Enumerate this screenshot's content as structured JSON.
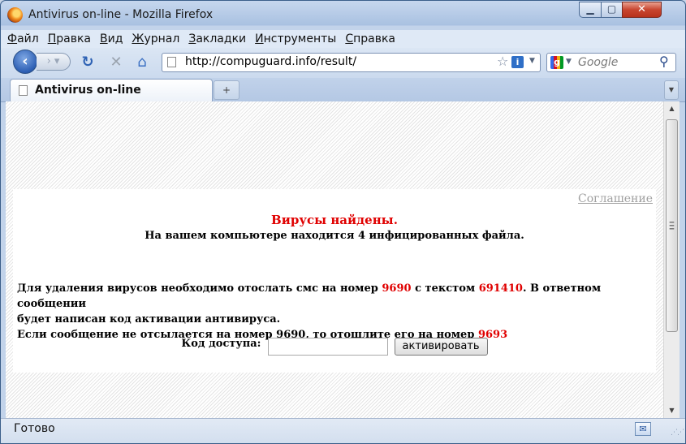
{
  "window": {
    "title": "Antivirus on-line - Mozilla Firefox",
    "minimize_glyph": "▁",
    "maximize_glyph": "▢",
    "close_glyph": "✕"
  },
  "menu": {
    "items": [
      {
        "accel": "Ф",
        "rest": "айл"
      },
      {
        "accel": "П",
        "rest": "равка"
      },
      {
        "accel": "В",
        "rest": "ид"
      },
      {
        "accel": "Ж",
        "rest": "урнал"
      },
      {
        "accel": "З",
        "rest": "акладки"
      },
      {
        "accel": "И",
        "rest": "нструменты"
      },
      {
        "accel": "С",
        "rest": "правка"
      }
    ]
  },
  "nav": {
    "url": "http://compuguard.info/result/",
    "search_placeholder": "Google",
    "icons": {
      "back": "back-arrow-icon",
      "forward": "forward-arrow-icon",
      "reload": "reload-icon",
      "stop": "stop-icon",
      "home": "home-icon",
      "bookmark": "star-icon",
      "site_info": "info-icon",
      "search_engine": "google-icon",
      "search": "search-icon"
    }
  },
  "tabs": {
    "active_label": "Antivirus on-line",
    "new_tab_glyph": "+",
    "list_glyph": "▼"
  },
  "page": {
    "agreement_link": "Соглашение",
    "title": "Вирусы найдены.",
    "subtitle": "На вашем компьютере находится 4 инфицированных файла.",
    "instr_line1_a": "Для удаления вирусов необходимо отослать смс на номер ",
    "sms_number": "9690",
    "instr_line1_b": " с текстом ",
    "sms_text": "691410",
    "instr_line1_c": ". В ответном сообщении",
    "instr_line2": "будет написан код активации антивируса.",
    "instr_line3_a": "Если сообщение не отсылается на номер 9690, то отошлите его на номер ",
    "alt_number": "9693",
    "code_label": "Код доступа:",
    "activate_button": "активировать",
    "accent_color": "#e00000"
  },
  "status": {
    "text": "Готово"
  }
}
